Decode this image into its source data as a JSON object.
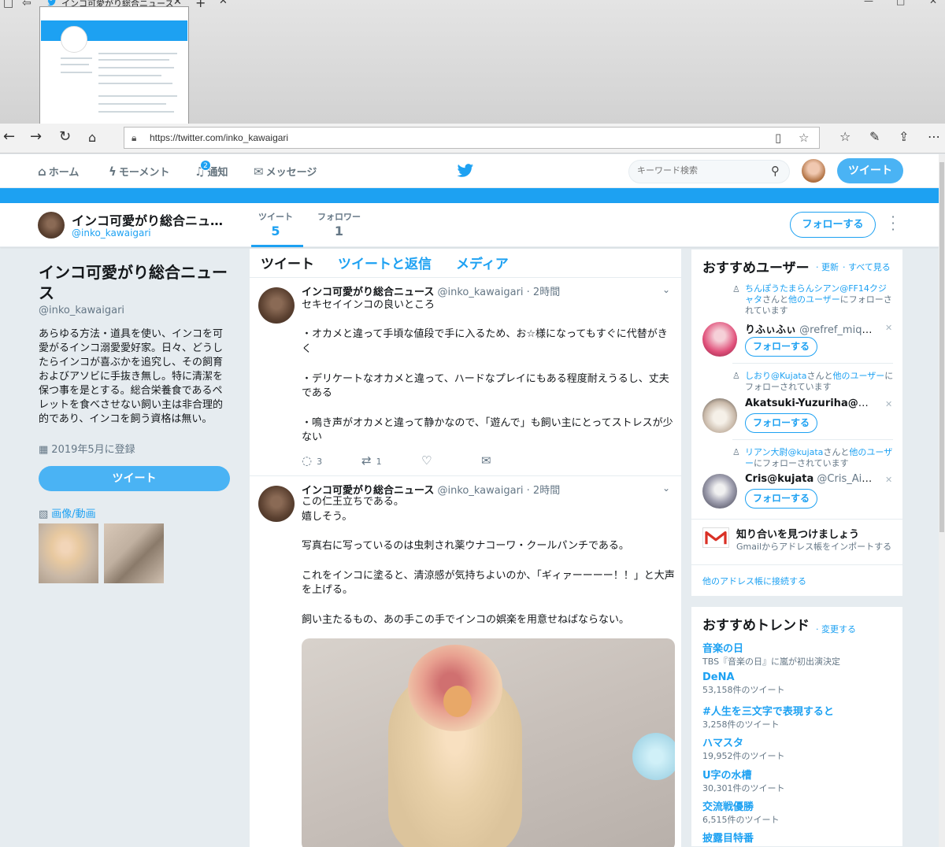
{
  "browser": {
    "tab_title": "インコ可愛がり総合ニュース",
    "url": "https://twitter.com/inko_kawaigari"
  },
  "nav": {
    "home": "ホーム",
    "moments": "モーメント",
    "notifications": "通知",
    "notification_count": "2",
    "messages": "メッセージ",
    "search_placeholder": "キーワード検索",
    "tweet_button": "ツイート"
  },
  "profile_nav": {
    "name": "インコ可愛がり総合ニュース",
    "handle": "@inko_kawaigari",
    "tweets_label": "ツイート",
    "tweets_count": "5",
    "followers_label": "フォロワー",
    "followers_count": "1",
    "follow_button": "フォローする"
  },
  "profile": {
    "name": "インコ可愛がり総合ニュース",
    "handle": "@inko_kawaigari",
    "bio": "あらゆる方法・道具を使い、インコを可愛がるインコ溺愛愛好家。日々、どうしたらインコが喜ぶかを追究し、その飼育およびアソビに手抜き無し。特に清潔を保つ事を是とする。総合栄養食であるペレットを食べさせない飼い主は非合理的的であり、インコを飼う資格は無い。",
    "joined": "2019年5月に登録",
    "tweet_button": "ツイート",
    "media_label": "画像/動画"
  },
  "timeline": {
    "tabs": [
      "ツイート",
      "ツイートと返信",
      "メディア"
    ],
    "tweets": [
      {
        "name": "インコ可愛がり総合ニュース",
        "handle": "@inko_kawaigari",
        "time": "· 2時間",
        "text": "セキセイインコの良いところ\n\n・オカメと違って手頃な値段で手に入るため、お☆様になってもすぐに代替がきく\n\n・デリケートなオカメと違って、ハードなプレイにもある程度耐えうるし、丈夫である\n\n・鳴き声がオカメと違って静かなので、「遊んで」も飼い主にとってストレスが少ない",
        "replies": "3",
        "retweets": "1"
      },
      {
        "name": "インコ可愛がり総合ニュース",
        "handle": "@inko_kawaigari",
        "time": "· 2時間",
        "text": "この仁王立ちである。\n嬉しそう。\n\n写真右に写っているのは虫刺され薬ウナコーワ・クールパンチである。\n\nこれをインコに塗ると、清涼感が気持ちよいのか、「ギィァーーーー！！」と大声を上げる。\n\n飼い主たるもの、あの手この手でインコの娯楽を用意せねばならない。"
      }
    ]
  },
  "who_to_follow": {
    "title": "おすすめユーザー",
    "refresh": "· 更新",
    "view_all": "· すべて見る",
    "follow_label": "フォローする",
    "users": [
      {
        "context_link": "ちんぽうたまらんシアン@FF14クジャタ",
        "context_rest": "さんと",
        "context_link2": "他のユーザー",
        "context_end": "にフォローされています",
        "name": "りふぃふぃ",
        "handle": "@refref_miqo...",
        "avatar_color": "#e0507a"
      },
      {
        "context_link": "しおり@Kujata",
        "context_rest": "さんと",
        "context_link2": "他のユーザー",
        "context_end": "にフォローされています",
        "name": "Akatsuki-Yuzuriha@Kuja...",
        "handle": "",
        "avatar_color": "#c8b8a8"
      },
      {
        "context_link": "リアン大尉@kujata",
        "context_rest": "さんと",
        "context_link2": "他のユーザー",
        "context_end": "にフォローされています",
        "name": "Cris@kujata",
        "handle": "@Cris_Aither",
        "avatar_color": "#6a6a7a"
      }
    ],
    "gmail_title": "知り合いを見つけましょう",
    "gmail_sub": "Gmailからアドレス帳をインポートする",
    "other_link": "他のアドレス帳に接続する"
  },
  "trends": {
    "title": "おすすめトレンド",
    "change": "· 変更する",
    "items": [
      {
        "name": "音楽の日",
        "sub": "TBS『音楽の日』に嵐が初出演決定"
      },
      {
        "name": "DeNA",
        "sub": "53,158件のツイート"
      },
      {
        "name": "#人生を三文字で表現すると",
        "sub": "3,258件のツイート"
      },
      {
        "name": "ハマスタ",
        "sub": "19,952件のツイート"
      },
      {
        "name": "U字の水槽",
        "sub": "30,301件のツイート"
      },
      {
        "name": "交流戦優勝",
        "sub": "6,515件のツイート"
      },
      {
        "name": "披露目特番",
        "sub": ""
      }
    ]
  }
}
